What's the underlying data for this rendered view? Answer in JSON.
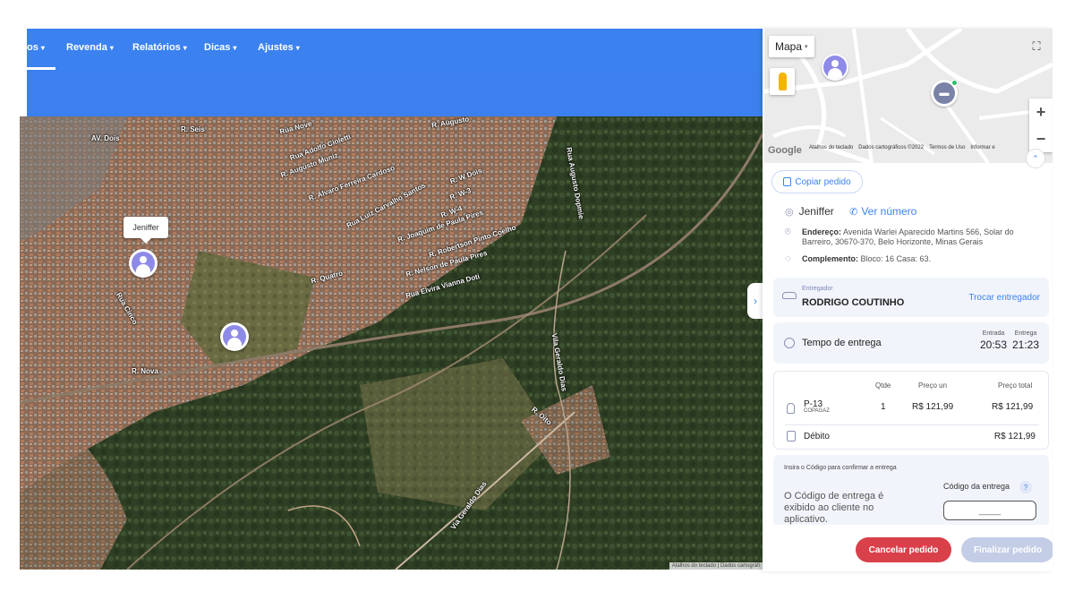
{
  "nav": {
    "items": [
      {
        "label": "os",
        "caret": "▾"
      },
      {
        "label": "Revenda",
        "caret": "▾"
      },
      {
        "label": "Relatórios",
        "caret": "▾"
      },
      {
        "label": "Dicas",
        "caret": "▾"
      },
      {
        "label": "Ajustes",
        "caret": "▾"
      }
    ]
  },
  "map": {
    "tooltip": {
      "label": "Jeniffer",
      "close": "×"
    },
    "street_labels": [
      "AV. Dois",
      "Rua Nove",
      "R. Seis",
      "R. Augusto",
      "Rua Adolfo Cioletti",
      "R. Augusto Muniz",
      "R. Álvaro Ferreira Cardoso",
      "Rua Luiz Carvalho Santos",
      "R. W Dois",
      "R. W-3",
      "R. W-4",
      "R. Joaquim de Paula Pires",
      "R. Robertson Pinto Coelho",
      "R. Nelson de Paula Pires",
      "Rua Elvira Vianna Doti",
      "Rua Augusto Dopmie",
      "R. Quatro",
      "R. Nova",
      "Rua Cinco",
      "Vila Geraldo Dias",
      "Via Geraldo Dias",
      "R. Oito"
    ],
    "attribution": "Atalhos do teclado | Dados cartográfi"
  },
  "minimap": {
    "type_label": "Mapa",
    "type_caret": "▾",
    "fullscreen_icon": "⛶",
    "zoom_in": "+",
    "zoom_out": "−",
    "google": "Google",
    "attribution": [
      "Atalhos do teclado",
      "Dados cartográficos ©2022",
      "Termos de Uso",
      "Informar e"
    ],
    "chevron": "⌃"
  },
  "panel": {
    "collapse_icon": "›",
    "copy_label": "Copiar pedido",
    "customer": {
      "name": "Jeniffer",
      "phone_label": "Ver número",
      "address_label": "Endereço:",
      "address": "Avenida Warlei Aparecido Martins 566, Solar do Barreiro, 30670-370, Belo Horizonte, Minas Gerais",
      "complement_label": "Complemento:",
      "complement": "Bloco: 16 Casa: 63."
    },
    "driver": {
      "label": "Entregador",
      "name": "RODRIGO COUTINHO",
      "change": "Trocar entregador"
    },
    "time": {
      "label": "Tempo de entrega",
      "entry_label": "Entrada",
      "entry": "20:53",
      "delivery_label": "Entrega",
      "delivery": "21:23"
    },
    "order": {
      "headers": {
        "qty": "Qtde",
        "unit": "Preço un",
        "total": "Preço total"
      },
      "product": "P-13",
      "brand": "COPAGAZ",
      "qty": "1",
      "unit_price": "R$ 121,99",
      "total_price": "R$ 121,99",
      "payment": "Débito",
      "payment_total": "R$ 121,99"
    },
    "code": {
      "title": "Insira o Código para confirmar a entrega",
      "description": "O Código de entrega é exibido ao cliente no aplicativo.",
      "field_label": "Código da entrega",
      "help": "?",
      "placeholder": "____"
    },
    "buttons": {
      "cancel": "Cancelar pedido",
      "finish": "Finalizar pedido"
    }
  },
  "colors": {
    "primary": "#3b82f0",
    "danger": "#d9404a",
    "disabled": "#c4cde6",
    "avatar": "#8e8be8"
  }
}
